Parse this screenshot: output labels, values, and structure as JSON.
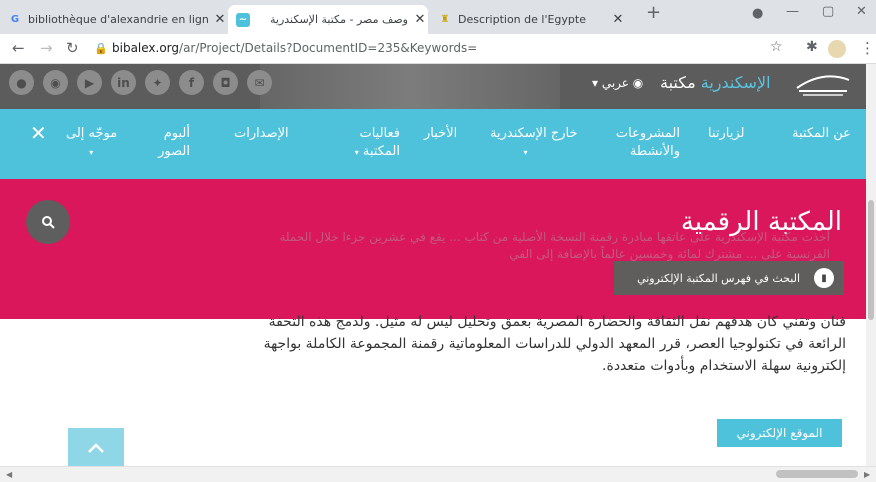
{
  "browser": {
    "tabs": [
      {
        "title": "bibliothèque d'alexandrie en ligne",
        "favicon": "G",
        "active": false
      },
      {
        "title": "وصف مصر - مكتبة الإسكندرية",
        "favicon": "bibalex-icon",
        "active": true
      },
      {
        "title": "Description de l'Egypte",
        "favicon": "archive-icon",
        "active": false
      }
    ],
    "new_tab": "+",
    "url_host": "bibalex.org",
    "url_path": "/ar/Project/Details?DocumentID=235&Keywords="
  },
  "site": {
    "brand_prefix": "مكتبة",
    "brand_highlight": "الإسكندرية",
    "language": "عربي",
    "social": [
      "instagram-pin-icon",
      "rss-icon",
      "youtube-icon",
      "linkedin-icon",
      "twitter-icon",
      "facebook-icon",
      "instagram-icon",
      "email-icon"
    ],
    "social_labels": {
      "linkedin": "in",
      "facebook": "f"
    }
  },
  "nav": {
    "items": [
      {
        "label": "عن المكتبة"
      },
      {
        "label": "لزيارتنا"
      },
      {
        "label": "المشروعات والأنشطة"
      },
      {
        "label": "خارج الإسكندرية"
      },
      {
        "label": "الأخبار"
      },
      {
        "label": "فعاليات المكتبة"
      },
      {
        "label": "الإصدارات"
      },
      {
        "label": "ألبوم الصور"
      },
      {
        "label": "موجّه إلى"
      }
    ]
  },
  "hero": {
    "title": "المكتبة الرقمية",
    "ghost_text": "أخذت مكتبة الإسكندرية على عاتقها مبادرة رقمنة النسخة الأصلية من كتاب ... يقع في عشرين جزءا خلال الحملة الفرنسية على ... مشترك لمائة وخمسين عالماً بالإضافة إلى الفي",
    "catalog_button": "البحث في فهرس المكتبة الإلكتروني"
  },
  "content": {
    "paragraph": "فنان وتقني كان هدفهم نقل الثقافة والحضارة المصرية بعمق وتحليل ليس له مثيل. ولدمج هذه التحفة الرائعة في تكنولوجيا العصر، قرر المعهد الدولي للدراسات المعلوماتية رقمنة المجموعة الكاملة بواجهة إلكترونية سهلة الاستخدام وبأدوات متعددة.",
    "site_button": "الموقع الإلكتروني"
  },
  "colors": {
    "accent": "#4ec1db",
    "hero": "#d9175a",
    "topbar": "#5c5c5c"
  }
}
